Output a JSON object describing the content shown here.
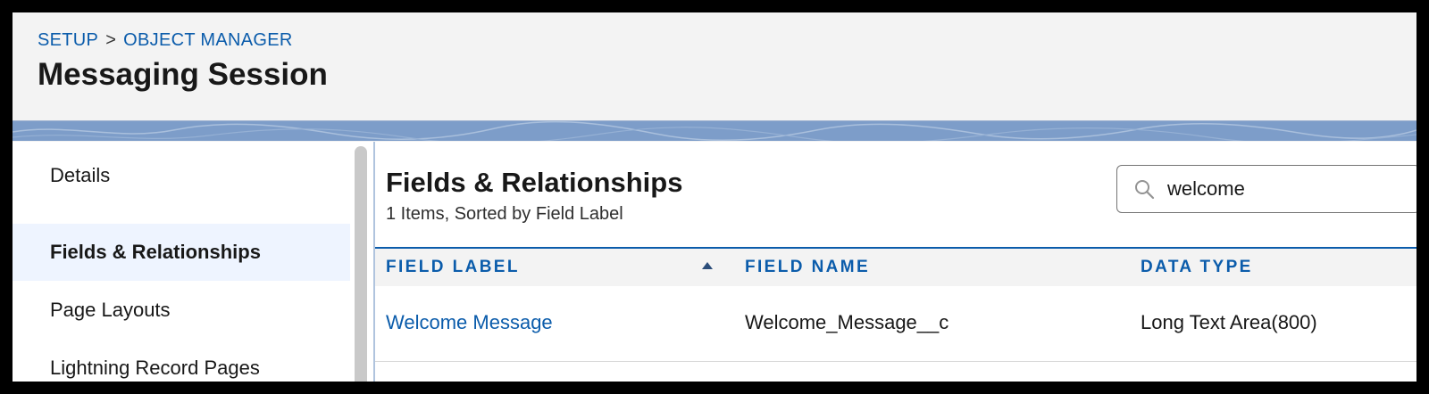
{
  "breadcrumb": {
    "setup": "SETUP",
    "separator": ">",
    "object_manager": "OBJECT MANAGER"
  },
  "page_title": "Messaging Session",
  "sidebar": {
    "items": [
      {
        "label": "Details",
        "active": false
      },
      {
        "label": "Fields & Relationships",
        "active": true
      },
      {
        "label": "Page Layouts",
        "active": false
      },
      {
        "label": "Lightning Record Pages",
        "active": false
      }
    ]
  },
  "main": {
    "title": "Fields & Relationships",
    "subtitle": "1 Items, Sorted by Field Label",
    "search": {
      "value": "welcome",
      "icon": "search-icon"
    },
    "table": {
      "columns": [
        "FIELD LABEL",
        "FIELD NAME",
        "DATA TYPE"
      ],
      "sort_icon": "sort-ascending-icon",
      "rows": [
        {
          "field_label": "Welcome Message",
          "field_name": "Welcome_Message__c",
          "data_type": "Long Text Area(800)"
        }
      ]
    }
  },
  "colors": {
    "link": "#0b5cab",
    "band": "#7d9dc9",
    "active_item_bg": "#eef4ff"
  }
}
